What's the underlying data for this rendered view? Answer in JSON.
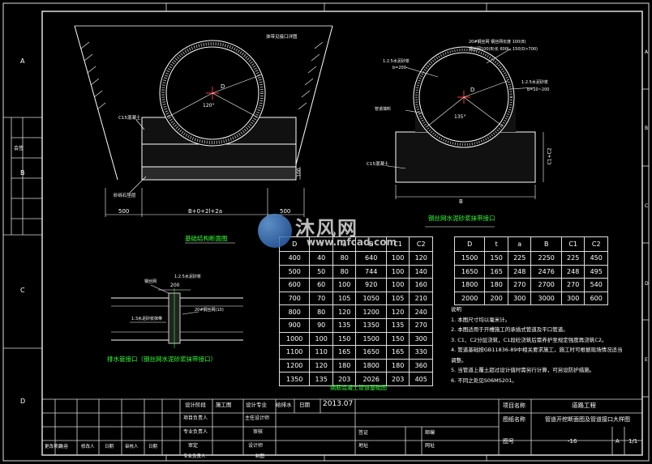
{
  "drawing": {
    "left_title": "基础结构断面图",
    "right_title": "钢丝网水泥砂浆抹带接口",
    "joint_title": "排水管接口（钢丝网水泥砂浆抹带接口）",
    "table_caption": "钢筋混凝土管道基础图",
    "left_view": {
      "dim_bottom_left": "500",
      "dim_bottom_mid": "B+0+2l+2a",
      "dim_bottom_right": "500",
      "dim_D": "D",
      "angle": "120°",
      "label_c15": "C15混凝土",
      "label_sand": "砂砾石垫层",
      "label_top": "抹带见接口详图",
      "dim_side": "100"
    },
    "right_view": {
      "label_mesh1": "20#钢丝网 钢丝网长度 100(B)",
      "label_mesh2": "钢丝网100(B)长 600L, 150(D>700)",
      "label_mortar1": "1:2.5水泥砂浆",
      "label_mortar2": "b=200",
      "label_mortar3": "1:2.5水泥砂浆",
      "label_mortar4": "b=10~200",
      "label_fill": "管道填料",
      "label_c15": "C15混凝土",
      "angle": "135°",
      "dim_D": "D",
      "dim_B": "B",
      "dim_side": "C1+C2"
    },
    "joint_view": {
      "label1": "钢丝网",
      "label2": "1:2.5水泥砂浆",
      "dim": "200",
      "label3": "20#钢丝网(10)",
      "label4": "1:3水泥砂浆抹带"
    },
    "watermark": {
      "cn": "沐风网",
      "en": "www.mfcad.com"
    },
    "border_labels": {
      "left": [
        "A",
        "B",
        "C",
        "D"
      ],
      "right": [
        "A",
        "B",
        "C",
        "D",
        "E"
      ]
    }
  },
  "main_table": {
    "headers": [
      "D",
      "t",
      "a",
      "B",
      "C1",
      "C2"
    ],
    "rows": [
      [
        "400",
        "40",
        "80",
        "640",
        "100",
        "120"
      ],
      [
        "500",
        "50",
        "80",
        "744",
        "100",
        "140"
      ],
      [
        "600",
        "60",
        "100",
        "920",
        "100",
        "160"
      ],
      [
        "700",
        "70",
        "105",
        "1050",
        "105",
        "210"
      ],
      [
        "800",
        "80",
        "120",
        "1200",
        "120",
        "240"
      ],
      [
        "900",
        "90",
        "135",
        "1350",
        "135",
        "270"
      ],
      [
        "1000",
        "100",
        "150",
        "1500",
        "150",
        "300"
      ],
      [
        "1100",
        "110",
        "165",
        "1650",
        "165",
        "330"
      ],
      [
        "1200",
        "120",
        "180",
        "1800",
        "180",
        "360"
      ],
      [
        "1350",
        "135",
        "203",
        "2026",
        "203",
        "405"
      ]
    ]
  },
  "right_table": {
    "headers": [
      "D",
      "t",
      "a",
      "B",
      "C1",
      "C2"
    ],
    "rows": [
      [
        "1500",
        "150",
        "225",
        "2250",
        "225",
        "450"
      ],
      [
        "1650",
        "165",
        "248",
        "2476",
        "248",
        "495"
      ],
      [
        "1800",
        "180",
        "270",
        "2700",
        "270",
        "540"
      ],
      [
        "2000",
        "200",
        "300",
        "3000",
        "300",
        "600"
      ]
    ]
  },
  "notes": {
    "title": "说明",
    "items": [
      "1. 本图尺寸均以毫米计。",
      "2. 本图适用于开槽施工的承插式管道及平口管道。",
      "3. C1、C2分层浇筑，C1段砼浇筑后需养护至规定强度再浇筑C2。",
      "4. 管道基础按GB11836-89中相关要求施工，施工时可根据现场情况适当调整。",
      "5. 当管道上覆土超过设计值时需另行计算，可另设防护措施。",
      "6. 不同之处见S06MS201。"
    ]
  },
  "title_block": {
    "r1": [
      "设计阶段",
      "施工图",
      "设计专业",
      "给排水",
      "日期",
      "2013.07"
    ],
    "r2": [
      "项目负责人",
      "",
      "主任设计师",
      ""
    ],
    "r3": [
      "专业负责人",
      "",
      "审核",
      ""
    ],
    "r4": [
      "审定",
      "",
      "设计师",
      ""
    ],
    "r5": [
      "专业负责人",
      "",
      "制图",
      ""
    ],
    "left_labels": [
      "更改项目",
      "内容",
      "修改人",
      "日期",
      "审核人",
      "日期"
    ],
    "project_label": "项目名称",
    "project_value": "道路工程",
    "drawing_label": "图纸名称",
    "drawing_value": "管道开挖断面图及管道接口大样图",
    "no_label": "图号",
    "no_value": "-16",
    "size": "A",
    "sheet": "1/1",
    "sign1": "签证",
    "sign2": "邮编",
    "sign3": "地址",
    "sign4": "网址"
  },
  "side_labels": {
    "left_stamp": "会签"
  }
}
